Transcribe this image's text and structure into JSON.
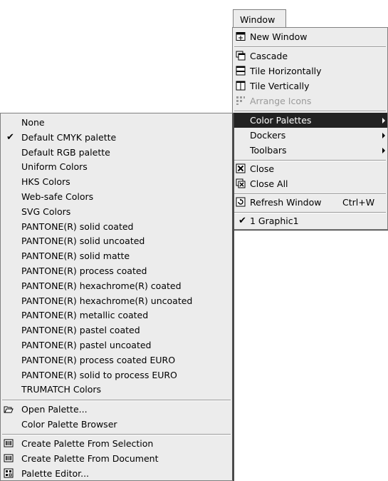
{
  "window_menu": {
    "title": "Window",
    "items": {
      "new_window": "New Window",
      "cascade": "Cascade",
      "tile_horizontally": "Tile Horizontally",
      "tile_vertically": "Tile Vertically",
      "arrange_icons": "Arrange Icons",
      "color_palettes": "Color Palettes",
      "dockers": "Dockers",
      "toolbars": "Toolbars",
      "close": "Close",
      "close_all": "Close All",
      "refresh_window": "Refresh Window",
      "refresh_shortcut": "Ctrl+W",
      "graphic": "1 Graphic1"
    }
  },
  "palette_menu": {
    "items": [
      "None",
      "Default CMYK palette",
      "Default RGB palette",
      "Uniform Colors",
      "HKS Colors",
      "Web-safe Colors",
      "SVG Colors",
      "PANTONE(R) solid coated",
      "PANTONE(R) solid uncoated",
      "PANTONE(R) solid matte",
      "PANTONE(R) process coated",
      "PANTONE(R) hexachrome(R) coated",
      "PANTONE(R) hexachrome(R) uncoated",
      "PANTONE(R) metallic coated",
      "PANTONE(R) pastel coated",
      "PANTONE(R) pastel uncoated",
      "PANTONE(R) process coated EURO",
      "PANTONE(R) solid to process EURO",
      "TRUMATCH Colors"
    ],
    "checked_index": 1,
    "open_palette": "Open Palette...",
    "color_palette_browser": "Color Palette Browser",
    "create_from_selection": "Create Palette From Selection",
    "create_from_document": "Create Palette From Document",
    "palette_editor": "Palette Editor..."
  },
  "colors": {
    "menu_bg": "#ececec",
    "highlight_bg": "#222222",
    "disabled_text": "#9a9a9a"
  }
}
